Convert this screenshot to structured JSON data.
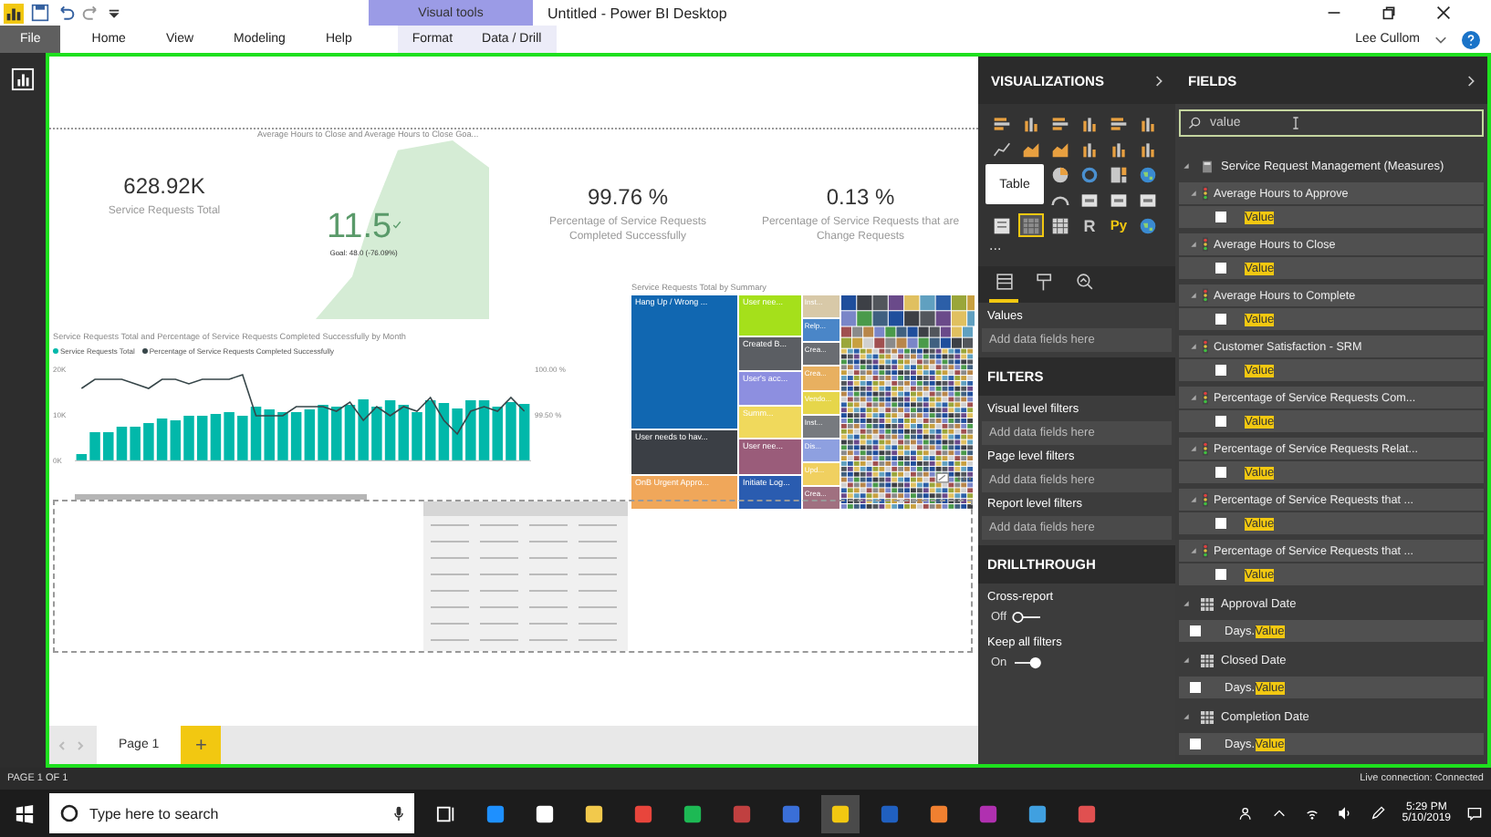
{
  "title_bar": {
    "context_label": "Visual tools",
    "title": "Untitled - Power BI Desktop"
  },
  "ribbon": {
    "tabs": [
      {
        "label": "File",
        "kind": "file"
      },
      {
        "label": "Home",
        "kind": "main"
      },
      {
        "label": "View",
        "kind": "main"
      },
      {
        "label": "Modeling",
        "kind": "main"
      },
      {
        "label": "Help",
        "kind": "main"
      },
      {
        "label": "Format",
        "kind": "context"
      },
      {
        "label": "Data / Drill",
        "kind": "context"
      }
    ],
    "user": "Lee Cullom"
  },
  "canvas": {
    "cards": [
      {
        "value": "628.92K",
        "label": "Service Requests Total"
      },
      {
        "value": "99.76 %",
        "label": "Percentage of Service Requests Completed Successfully"
      },
      {
        "value": "0.13 %",
        "label": "Percentage of Service Requests that are Change Requests"
      }
    ],
    "kpi": {
      "title": "Average Hours to Close and Average Hours to Close Goa...",
      "value": "11.5",
      "goal": "Goal: 48.0 (-76.09%)"
    },
    "combo_chart": {
      "title": "Service Requests Total and Percentage of Service Requests Completed Successfully by Month",
      "columns": {
        "chart_data": {
          "type": "bar",
          "ylim": [
            0,
            20000
          ],
          "yticks": [
            {
              "value": 20000,
              "label": "20K"
            },
            {
              "value": 10000,
              "label": "10K"
            },
            {
              "value": 0,
              "label": "0K"
            }
          ],
          "series": [
            {
              "name": "Service Requests Total",
              "color": "#01b8aa",
              "values": [
                1600,
                6400,
                6400,
                7600,
                7600,
                8400,
                9400,
                9000,
                10000,
                10000,
                10400,
                10800,
                10000,
                12000,
                11400,
                10800,
                10800,
                11400,
                12400,
                12000,
                12400,
                13600,
                12000,
                13400,
                12400,
                10800,
                13400,
                12800,
                11600,
                13400,
                13400,
                12000,
                13000,
                12600
              ]
            }
          ]
        }
      },
      "line": {
        "chart_data": {
          "type": "line",
          "ylim": [
            99,
            100
          ],
          "yticks": [
            {
              "value": 100,
              "label": "100.00 %"
            },
            {
              "value": 99.5,
              "label": "99.50 %"
            }
          ],
          "series": [
            {
              "name": "Percentage of Service Requests Completed Successfully",
              "color": "#374649",
              "values": [
                99.8,
                99.9,
                99.9,
                99.9,
                99.85,
                99.8,
                99.9,
                99.9,
                99.85,
                99.9,
                99.9,
                99.9,
                99.95,
                99.5,
                99.5,
                99.5,
                99.6,
                99.6,
                99.6,
                99.55,
                99.65,
                99.45,
                99.6,
                99.5,
                99.6,
                99.55,
                99.7,
                99.45,
                99.3,
                99.55,
                99.6,
                99.55,
                99.7,
                99.55
              ]
            }
          ]
        }
      }
    },
    "treemap": {
      "title": "Service Requests Total by Summary",
      "tiles": [
        {
          "label": "Hang Up / Wrong ...",
          "color": "#1167b1"
        },
        {
          "label": "User needs to hav...",
          "color": "#3b3f45"
        },
        {
          "label": "OnB Urgent Appro...",
          "color": "#f0a75a"
        },
        {
          "label": "User nee...",
          "color": "#a5e01b"
        },
        {
          "label": "Created B...",
          "color": "#5b5e63"
        },
        {
          "label": "User's acc...",
          "color": "#8d8fe0"
        },
        {
          "label": "Summ...",
          "color": "#f0d95c"
        },
        {
          "label": "User nee...",
          "color": "#9a5c7a"
        },
        {
          "label": "Initiate Log...",
          "color": "#2a5cb0"
        },
        {
          "label": "Inst...",
          "color": "#d8c9a8"
        },
        {
          "label": "Relp...",
          "color": "#4a86c8"
        },
        {
          "label": "Crea...",
          "color": "#6a6d72"
        },
        {
          "label": "Crea...",
          "color": "#e8b060"
        },
        {
          "label": "Vendo...",
          "color": "#e6d64a"
        },
        {
          "label": "Inst...",
          "color": "#777a7f"
        },
        {
          "label": "Dis...",
          "color": "#8ea0e0"
        },
        {
          "label": "Upd...",
          "color": "#f0d060"
        },
        {
          "label": "Crea...",
          "color": "#a07080"
        }
      ]
    },
    "page_tabs": [
      {
        "label": "Page 1",
        "selected": true
      }
    ],
    "add_page": "+"
  },
  "visualizations": {
    "title": "VISUALIZATIONS",
    "tooltip": "Table",
    "gallery": [
      {
        "kind": "bar",
        "selected": false
      },
      {
        "kind": "column",
        "selected": false
      },
      {
        "kind": "bar",
        "selected": false
      },
      {
        "kind": "column",
        "selected": false
      },
      {
        "kind": "bar",
        "selected": false
      },
      {
        "kind": "column",
        "selected": false
      },
      {
        "kind": "line",
        "selected": false
      },
      {
        "kind": "area",
        "selected": false
      },
      {
        "kind": "area",
        "selected": false
      },
      {
        "kind": "column",
        "selected": false
      },
      {
        "kind": "column",
        "selected": false
      },
      {
        "kind": "column",
        "selected": false
      },
      {
        "kind": "pie",
        "selected": false
      },
      {
        "kind": "donut",
        "selected": false
      },
      {
        "kind": "treemap",
        "selected": false
      },
      {
        "kind": "map",
        "selected": false
      },
      {
        "kind": "gauge",
        "selected": false
      },
      {
        "kind": "card",
        "selected": false
      },
      {
        "kind": "card",
        "selected": false
      },
      {
        "kind": "card",
        "selected": false
      },
      {
        "kind": "slicer",
        "selected": false
      },
      {
        "kind": "table",
        "selected": true
      },
      {
        "kind": "matrix",
        "selected": false
      },
      {
        "kind": "script",
        "label": "R",
        "selected": false
      },
      {
        "kind": "script",
        "label": "Py",
        "selected": false
      },
      {
        "kind": "map",
        "selected": false
      }
    ],
    "more": "...",
    "pane_tabs": [
      {
        "kind": "fields",
        "selected": true
      },
      {
        "kind": "format",
        "selected": false
      },
      {
        "kind": "analytics",
        "selected": false
      }
    ],
    "values_label": "Values",
    "values_placeholder": "Add data fields here",
    "filters_title": "FILTERS",
    "filters": [
      {
        "label": "Visual level filters",
        "placeholder": "Add data fields here"
      },
      {
        "label": "Page level filters",
        "placeholder": "Add data fields here"
      },
      {
        "label": "Report level filters",
        "placeholder": "Add data fields here"
      }
    ],
    "drillthrough_title": "DRILLTHROUGH",
    "toggles": [
      {
        "label": "Cross-report",
        "state_text": "Off",
        "on": false
      },
      {
        "label": "Keep all filters",
        "state_text": "On",
        "on": true
      }
    ]
  },
  "fields": {
    "title": "FIELDS",
    "search": "value",
    "tree": [
      {
        "name": "Service Request Management (Measures)",
        "kind": "measures",
        "expanded": true,
        "children": [
          {
            "name": "Average Hours to Approve",
            "expanded": true,
            "children": [
              {
                "match": "Value",
                "checked": false
              }
            ]
          },
          {
            "name": "Average Hours to Close",
            "expanded": true,
            "children": [
              {
                "match": "Value",
                "checked": false
              }
            ]
          },
          {
            "name": "Average Hours to Complete",
            "expanded": true,
            "children": [
              {
                "match": "Value",
                "checked": false
              }
            ]
          },
          {
            "name": "Customer Satisfaction - SRM",
            "expanded": true,
            "children": [
              {
                "match": "Value",
                "checked": false
              }
            ]
          },
          {
            "name": "Percentage of Service Requests Com...",
            "expanded": true,
            "children": [
              {
                "match": "Value",
                "checked": false
              }
            ]
          },
          {
            "name": "Percentage of Service Requests Relat...",
            "expanded": true,
            "children": [
              {
                "match": "Value",
                "checked": false
              }
            ]
          },
          {
            "name": "Percentage of Service Requests that ...",
            "expanded": true,
            "children": [
              {
                "match": "Value",
                "checked": false
              }
            ]
          },
          {
            "name": "Percentage of Service Requests that ...",
            "expanded": true,
            "children": [
              {
                "match": "Value",
                "checked": false
              }
            ]
          }
        ]
      },
      {
        "name": "Approval Date",
        "kind": "table",
        "expanded": true,
        "children": [
          {
            "prefix": "Days.",
            "match": "Value",
            "checked": false
          }
        ]
      },
      {
        "name": "Closed Date",
        "kind": "table",
        "expanded": true,
        "children": [
          {
            "prefix": "Days.",
            "match": "Value",
            "checked": false
          }
        ]
      },
      {
        "name": "Completion Date",
        "kind": "table",
        "expanded": true,
        "children": [
          {
            "prefix": "Days.",
            "match": "Value",
            "checked": false
          }
        ]
      }
    ]
  },
  "status_bar": {
    "page": "PAGE 1 OF 1",
    "connection": "Live connection: Connected"
  },
  "taskbar": {
    "search_placeholder": "Type here to search",
    "time": "5:29 PM",
    "date": "5/10/2019"
  }
}
